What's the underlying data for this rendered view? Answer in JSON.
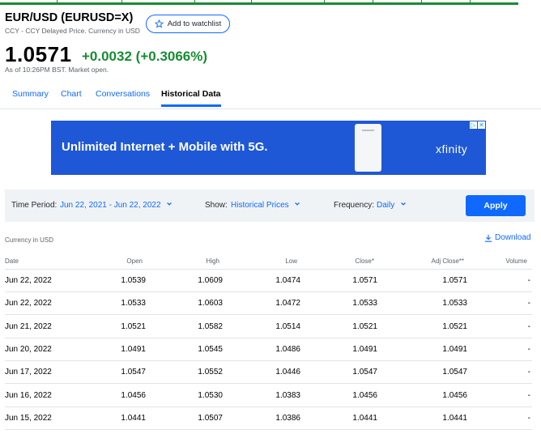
{
  "header": {
    "ticker": "EUR/USD (EURUSD=X)",
    "subtitle": "CCY - CCY Delayed Price. Currency in USD",
    "watchlist_label": "Add to watchlist",
    "price": "1.0571",
    "change": "+0.0032",
    "change_pct": "(+0.3066%)",
    "as_of": "As of 10:26PM BST. Market open."
  },
  "tabs": [
    {
      "label": "Summary"
    },
    {
      "label": "Chart"
    },
    {
      "label": "Conversations"
    },
    {
      "label": "Historical Data"
    }
  ],
  "ad": {
    "text": "Unlimited Internet + Mobile with 5G.",
    "brand": "xfinity",
    "badge_info": "▷",
    "badge_close": "✕"
  },
  "filters": {
    "time_period_label": "Time Period:",
    "time_period_value": "Jun 22, 2021 - Jun 22, 2022",
    "show_label": "Show:",
    "show_value": "Historical Prices",
    "frequency_label": "Frequency:",
    "frequency_value": "Daily",
    "apply_label": "Apply"
  },
  "table": {
    "currency_note": "Currency in USD",
    "download_label": "Download",
    "columns": [
      "Date",
      "Open",
      "High",
      "Low",
      "Close*",
      "Adj Close**",
      "Volume"
    ],
    "rows": [
      [
        "Jun 22, 2022",
        "1.0539",
        "1.0609",
        "1.0474",
        "1.0571",
        "1.0571",
        "-"
      ],
      [
        "Jun 22, 2022",
        "1.0533",
        "1.0603",
        "1.0472",
        "1.0533",
        "1.0533",
        "-"
      ],
      [
        "Jun 21, 2022",
        "1.0521",
        "1.0582",
        "1.0514",
        "1.0521",
        "1.0521",
        "-"
      ],
      [
        "Jun 20, 2022",
        "1.0491",
        "1.0545",
        "1.0486",
        "1.0491",
        "1.0491",
        "-"
      ],
      [
        "Jun 17, 2022",
        "1.0547",
        "1.0552",
        "1.0446",
        "1.0547",
        "1.0547",
        "-"
      ],
      [
        "Jun 16, 2022",
        "1.0456",
        "1.0530",
        "1.0383",
        "1.0456",
        "1.0456",
        "-"
      ],
      [
        "Jun 15, 2022",
        "1.0441",
        "1.0507",
        "1.0386",
        "1.0441",
        "1.0441",
        "-"
      ]
    ]
  },
  "colors": {
    "accent": "#0f69ff",
    "positive": "#188c33",
    "ad_background": "#1f58d6"
  }
}
